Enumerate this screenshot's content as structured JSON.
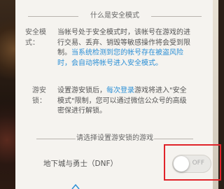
{
  "title_divider": "什么是安全模式",
  "rows": [
    {
      "label": "安全模式：",
      "text_plain": "当帐号处于安全模式时，该帐号在游戏的进行交易、丢弃、销毁等敏感操作将会受到限制。",
      "text_blue": "当系统检测到您的帐号存在被盗风险时，会自动将帐号进入安全模式。"
    },
    {
      "label": "游安锁：",
      "text_pre": "设置游安锁后，",
      "text_blue": "每次登录",
      "text_post": "游戏将进入\"安全模式\"限制，您可以通过微信公众号的高级密保进行解锁。"
    }
  ],
  "select_divider": "请选择设置游安锁的游戏",
  "game": {
    "name": "地下城与勇士（DNF）",
    "toggle_state": "OFF",
    "enabled": false
  },
  "colors": {
    "accent_blue": "#2b8fd6",
    "highlight_red": "#e0232a"
  }
}
